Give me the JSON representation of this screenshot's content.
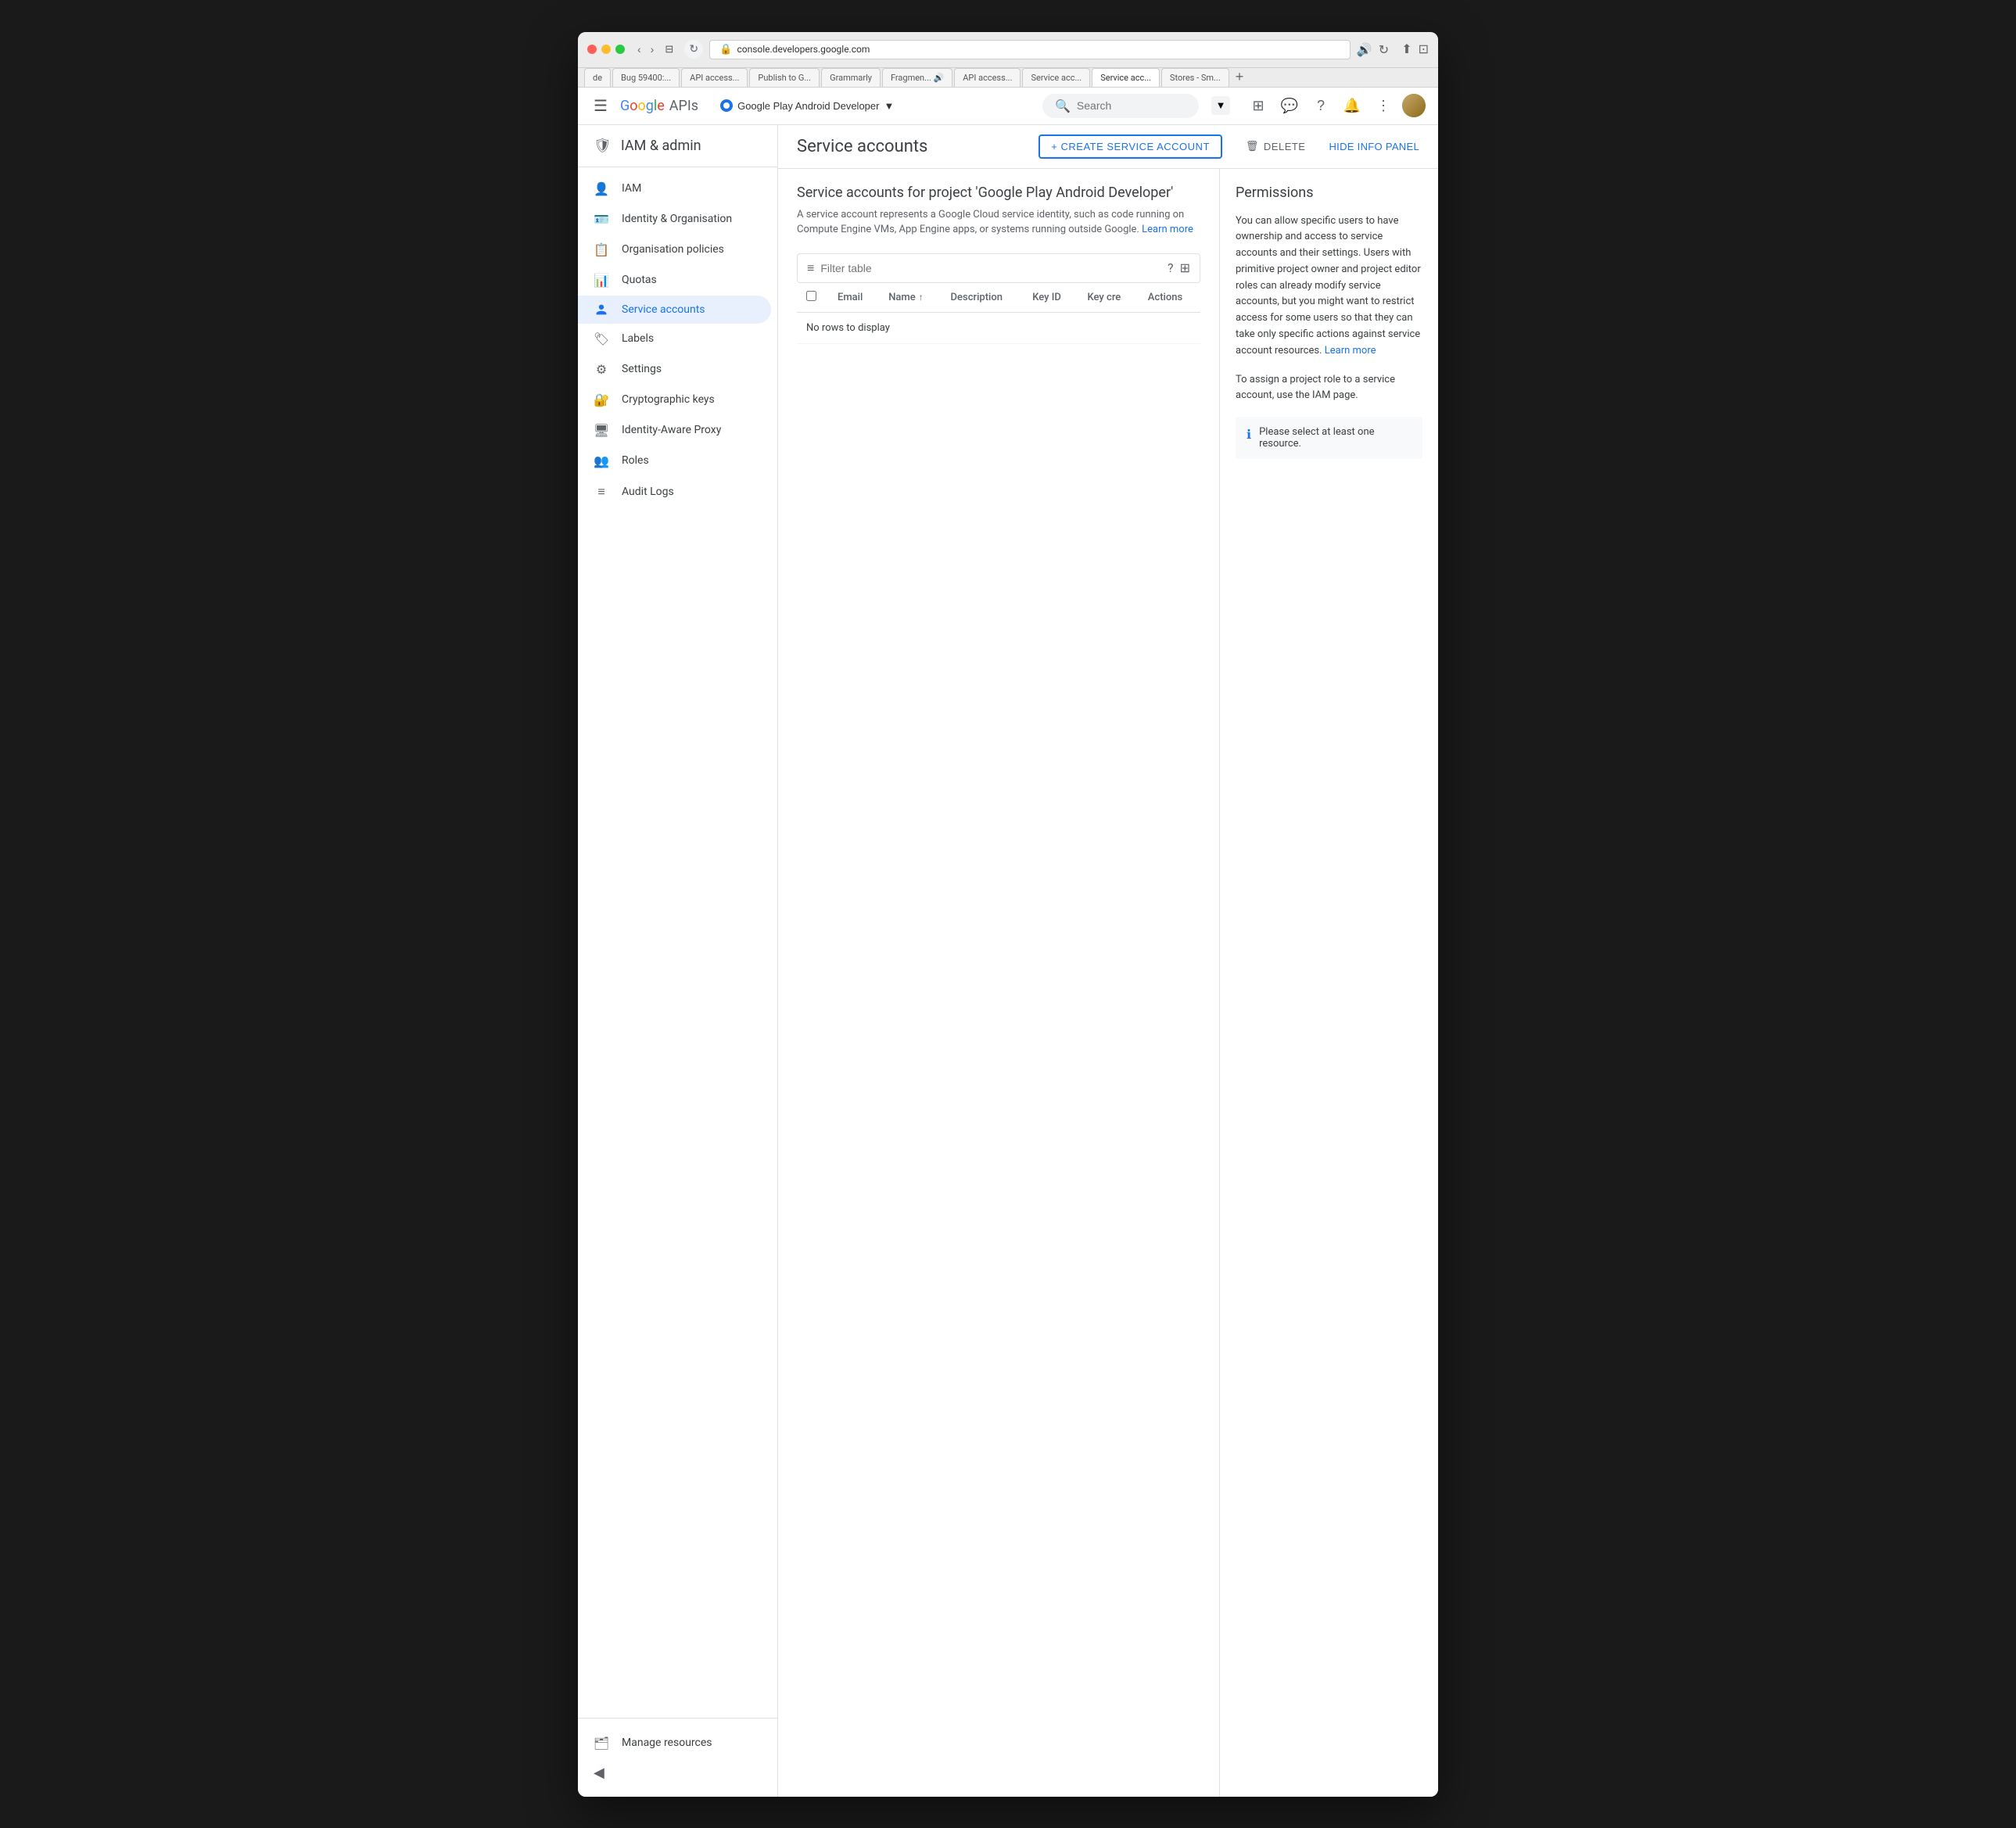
{
  "browser": {
    "traffic_lights": [
      "red",
      "yellow",
      "green"
    ],
    "url": "console.developers.google.com",
    "tabs": [
      {
        "label": "de",
        "active": false
      },
      {
        "label": "Bug 59400:...",
        "active": false
      },
      {
        "label": "API access...",
        "active": false
      },
      {
        "label": "Publish to G...",
        "active": false
      },
      {
        "label": "Grammarly",
        "active": false
      },
      {
        "label": "Fragmen... 🔊",
        "active": false
      },
      {
        "label": "API access...",
        "active": false
      },
      {
        "label": "Service acc...",
        "active": false
      },
      {
        "label": "Service acc...",
        "active": true
      },
      {
        "label": "Stores - Sm...",
        "active": false
      }
    ],
    "tab_add": "+"
  },
  "header": {
    "menu_icon": "☰",
    "logo_google": "Google",
    "logo_apis": " APIs",
    "project_name": "Google Play Android Developer",
    "project_dropdown_icon": "▼",
    "search_placeholder": "Search",
    "icons": [
      "⊞",
      "💬",
      "?",
      "🔔",
      "⋮"
    ],
    "search_icon": "🔍"
  },
  "sidebar": {
    "title": "IAM & admin",
    "shield_icon": "🛡",
    "nav_items": [
      {
        "id": "iam",
        "label": "IAM",
        "icon": "👤"
      },
      {
        "id": "identity",
        "label": "Identity & Organisation",
        "icon": "🪪"
      },
      {
        "id": "org-policies",
        "label": "Organisation policies",
        "icon": "📋"
      },
      {
        "id": "quotas",
        "label": "Quotas",
        "icon": "📊"
      },
      {
        "id": "service-accounts",
        "label": "Service accounts",
        "icon": "⚙",
        "active": true
      },
      {
        "id": "labels",
        "label": "Labels",
        "icon": "🏷"
      },
      {
        "id": "settings",
        "label": "Settings",
        "icon": "⚙"
      },
      {
        "id": "crypto-keys",
        "label": "Cryptographic keys",
        "icon": "🔐"
      },
      {
        "id": "identity-proxy",
        "label": "Identity-Aware Proxy",
        "icon": "🖥"
      },
      {
        "id": "roles",
        "label": "Roles",
        "icon": "👥"
      },
      {
        "id": "audit-logs",
        "label": "Audit Logs",
        "icon": "≡"
      }
    ],
    "footer": {
      "manage_resources_label": "Manage resources",
      "manage_icon": "🗂",
      "collapse_icon": "◀"
    }
  },
  "page": {
    "title": "Service accounts",
    "create_btn_label": "+ CREATE SERVICE ACCOUNT",
    "delete_btn_label": "🗑 DELETE",
    "hide_panel_btn_label": "HIDE INFO PANEL"
  },
  "service_accounts": {
    "section_title": "Service accounts for project 'Google Play Android Developer'",
    "description": "A service account represents a Google Cloud service identity, such as code running on Compute Engine VMs, App Engine apps, or systems running outside Google.",
    "learn_more_label": "Learn more",
    "filter_placeholder": "Filter table",
    "table": {
      "columns": [
        {
          "id": "checkbox",
          "label": ""
        },
        {
          "id": "email",
          "label": "Email"
        },
        {
          "id": "name",
          "label": "Name",
          "sortable": true
        },
        {
          "id": "description",
          "label": "Description"
        },
        {
          "id": "key_id",
          "label": "Key ID"
        },
        {
          "id": "key_cre",
          "label": "Key cre"
        },
        {
          "id": "actions",
          "label": "Actions"
        }
      ],
      "rows": [],
      "no_rows_message": "No rows to display"
    }
  },
  "permissions_panel": {
    "title": "Permissions",
    "text1": "You can allow specific users to have ownership and access to service accounts and their settings. Users with primitive project owner and project editor roles can already modify service accounts, but you might want to restrict access for some users so that they can take only specific actions against service account resources.",
    "learn_more_label": "Learn more",
    "text2": "To assign a project role to a service account, use the IAM page.",
    "notice": "Please select at least one resource.",
    "notice_icon": "ℹ"
  }
}
